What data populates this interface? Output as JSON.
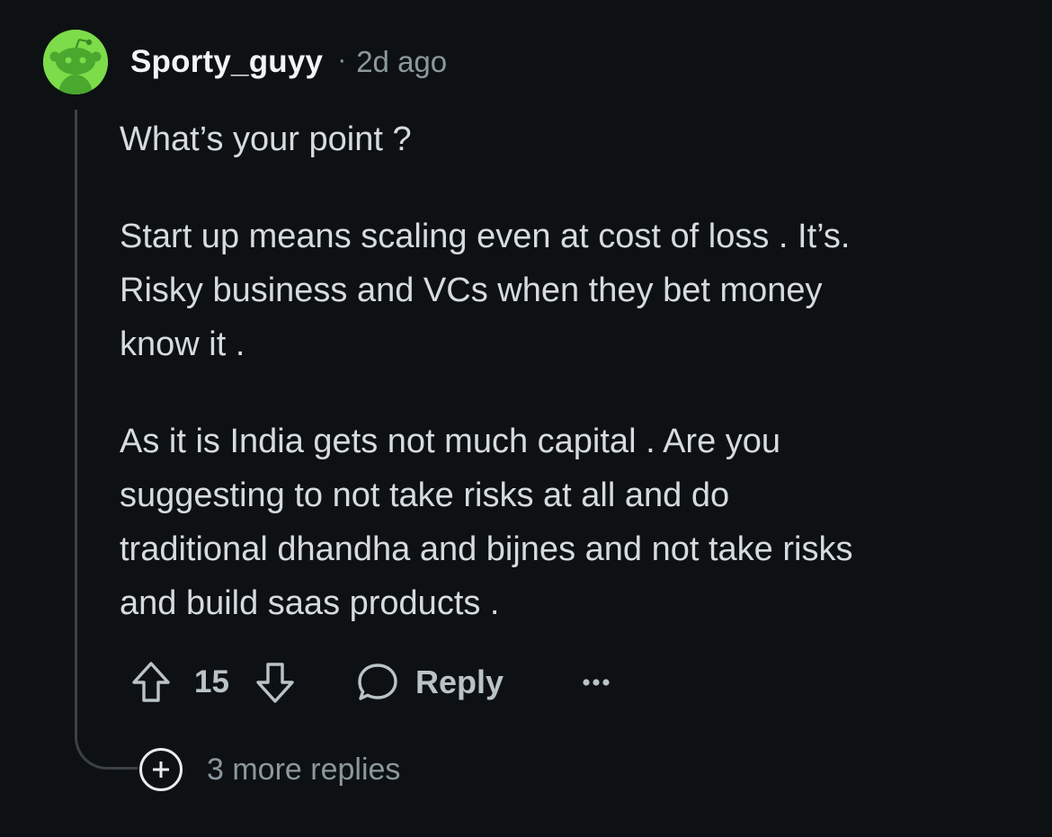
{
  "comment": {
    "author": "Sporty_guyy",
    "separator": "·",
    "time_ago": "2d ago",
    "avatar_icon": "snoo-avatar-icon",
    "avatar_color": "#7cdc4a",
    "paragraphs": [
      "What’s your point ?",
      "Start up means scaling even at cost of loss . It’s.\nRisky business and VCs when they bet money\nknow it .",
      "As it is India gets not much capital . Are you\nsuggesting to not take risks at all and do\ntraditional dhandha and bijnes and not take risks\nand build saas products ."
    ]
  },
  "actions": {
    "upvote_icon": "upvote-arrow-icon",
    "vote_count": "15",
    "downvote_icon": "downvote-arrow-icon",
    "reply_icon": "speech-bubble-icon",
    "reply_label": "Reply",
    "more_icon": "ellipsis-icon"
  },
  "more_replies": {
    "icon": "plus-circle-icon",
    "label": "3 more replies"
  },
  "colors": {
    "background": "#0e1113",
    "text_primary": "#d5dbdf",
    "text_secondary": "#8b989f",
    "thread_line": "#3b4246"
  }
}
